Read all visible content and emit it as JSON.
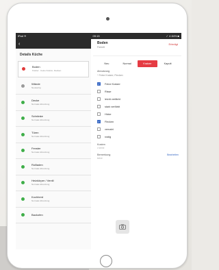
{
  "status": {
    "left": "iPad ✈",
    "time": "09:15",
    "right": "✓ 4 84% ■"
  },
  "left_panel": {
    "back": "‹",
    "title": "Details Küche",
    "items": [
      {
        "name": "Boden",
        "sub": "Kratzer · Feine Kratzer, Flecken",
        "color": "#e03a3a",
        "selected": true
      },
      {
        "name": "Wände",
        "sub": "Neuwertig",
        "color": "#9a9a9a"
      },
      {
        "name": "Decke",
        "sub": "Normale Abnutzung",
        "color": "#3fae49"
      },
      {
        "name": "Schränke",
        "sub": "Normale Abnutzung",
        "color": "#3fae49"
      },
      {
        "name": "Türen",
        "sub": "Normale Abnutzung",
        "color": "#3fae49"
      },
      {
        "name": "Fenster",
        "sub": "Normale Abnutzung",
        "color": "#3fae49"
      },
      {
        "name": "Rollladen",
        "sub": "Normale Abnutzung",
        "color": "#3fae49"
      },
      {
        "name": "Heizkörper / Ventil",
        "sub": "Normale Abnutzung",
        "color": "#3fae49"
      },
      {
        "name": "Kochherd",
        "sub": "Normale Abnutzung",
        "color": "#3fae49"
      },
      {
        "name": "Backofen",
        "sub": "",
        "color": "#3fae49"
      }
    ]
  },
  "right_panel": {
    "title": "Boden",
    "subtitle": "Parkett",
    "action": "Erledigt",
    "segments": [
      {
        "label": "Neu",
        "active": false
      },
      {
        "label": "Normal",
        "active": false
      },
      {
        "label": "Kratzer",
        "active": true
      },
      {
        "label": "Kaputt",
        "active": false
      }
    ],
    "section_label": "Abnutzung",
    "section_summary": "^ Feine Kratzer, Flecken",
    "options": [
      {
        "label": "Feine Kratzer",
        "checked": true
      },
      {
        "label": "Risse",
        "checked": false
      },
      {
        "label": "leicht verfärbt",
        "checked": false
      },
      {
        "label": "stark verfärbt",
        "checked": false
      },
      {
        "label": "Hicke",
        "checked": false
      },
      {
        "label": "Flecken",
        "checked": true
      },
      {
        "label": "vernabt",
        "checked": false
      },
      {
        "label": "rostig",
        "checked": false
      }
    ],
    "costs_label": "Kosten",
    "costs_value": "v keine",
    "remark_label": "Bemerkung",
    "remark_value": "keine",
    "remark_action": "Bearbeiten",
    "camera_icon": "camera-icon"
  }
}
